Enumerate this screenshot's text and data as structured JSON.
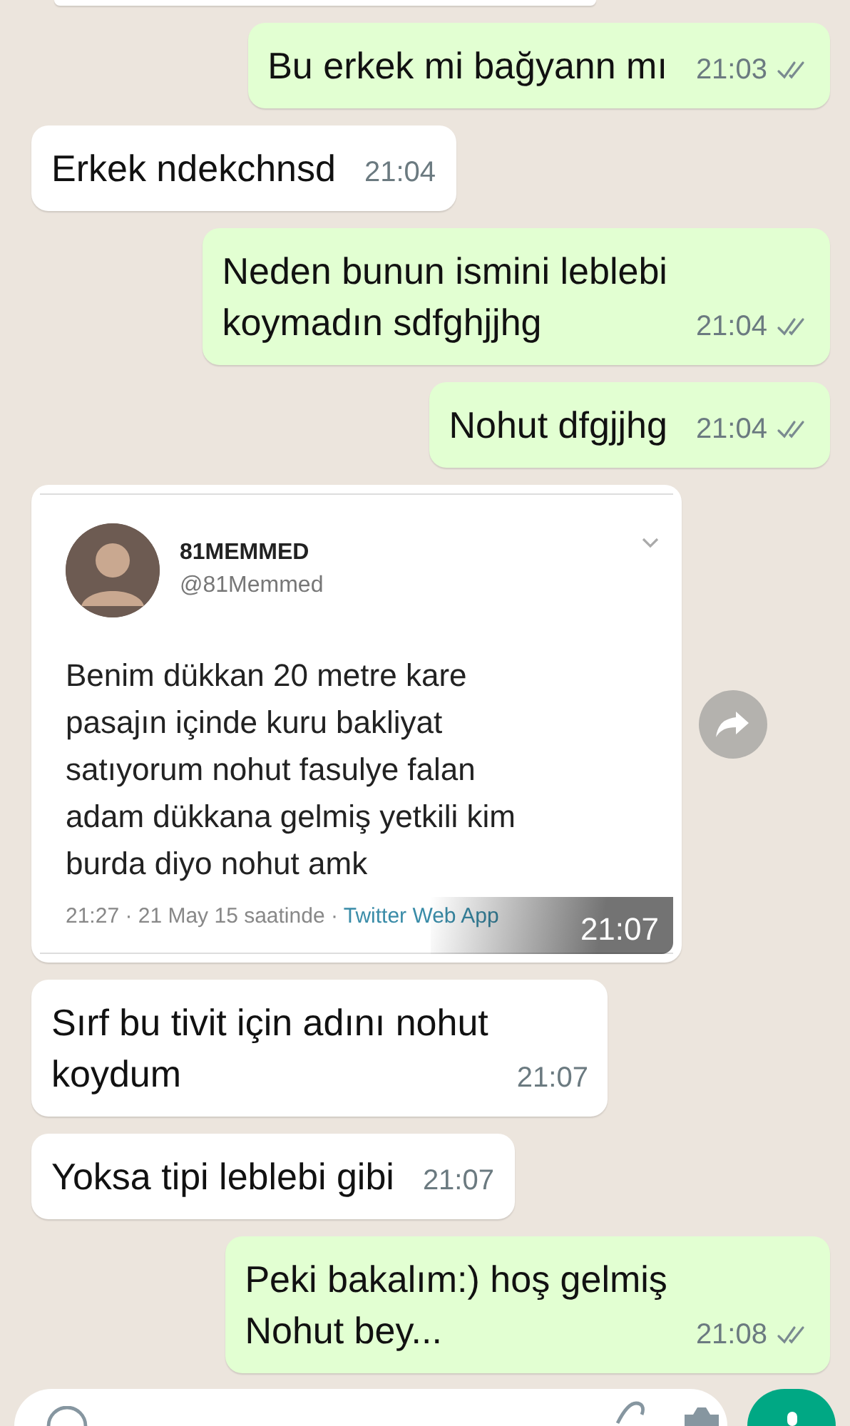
{
  "messages": [
    {
      "kind": "edge",
      "outgoing": false
    },
    {
      "kind": "text",
      "outgoing": true,
      "text": "Bu erkek mi bağyann mı",
      "time": "21:03",
      "delivered": true
    },
    {
      "kind": "text",
      "outgoing": false,
      "text": "Erkek ndekchnsd",
      "time": "21:04"
    },
    {
      "kind": "text",
      "outgoing": true,
      "text": "Neden bunun ismini leblebi\nkoymadın sdfghjjhg",
      "time": "21:04",
      "delivered": true
    },
    {
      "kind": "text",
      "outgoing": true,
      "text": "Nohut dfgjjhg",
      "time": "21:04",
      "delivered": true
    },
    {
      "kind": "tweet",
      "outgoing": false,
      "time": "21:07",
      "forward": true,
      "tweet": {
        "name": "81MEMMED",
        "handle": "@81Memmed",
        "text": "Benim dükkan 20 metre kare\npasajın içinde kuru bakliyat\nsatıyorum nohut fasulye falan\nadam dükkana gelmiş yetkili kim\nburda diyo nohut amk",
        "date": "21:27 · 21 May 15 saatinde ·",
        "source": "Twitter Web App"
      }
    },
    {
      "kind": "text",
      "outgoing": false,
      "text": "Sırf bu tivit için adını nohut\nkoydum",
      "time": "21:07"
    },
    {
      "kind": "text",
      "outgoing": false,
      "text": "Yoksa tipi leblebi gibi",
      "time": "21:07"
    },
    {
      "kind": "text",
      "outgoing": true,
      "text": "Peki bakalım:) hoş gelmiş\nNohut bey...",
      "time": "21:08",
      "delivered": true
    }
  ],
  "composer": {
    "visible": true
  }
}
